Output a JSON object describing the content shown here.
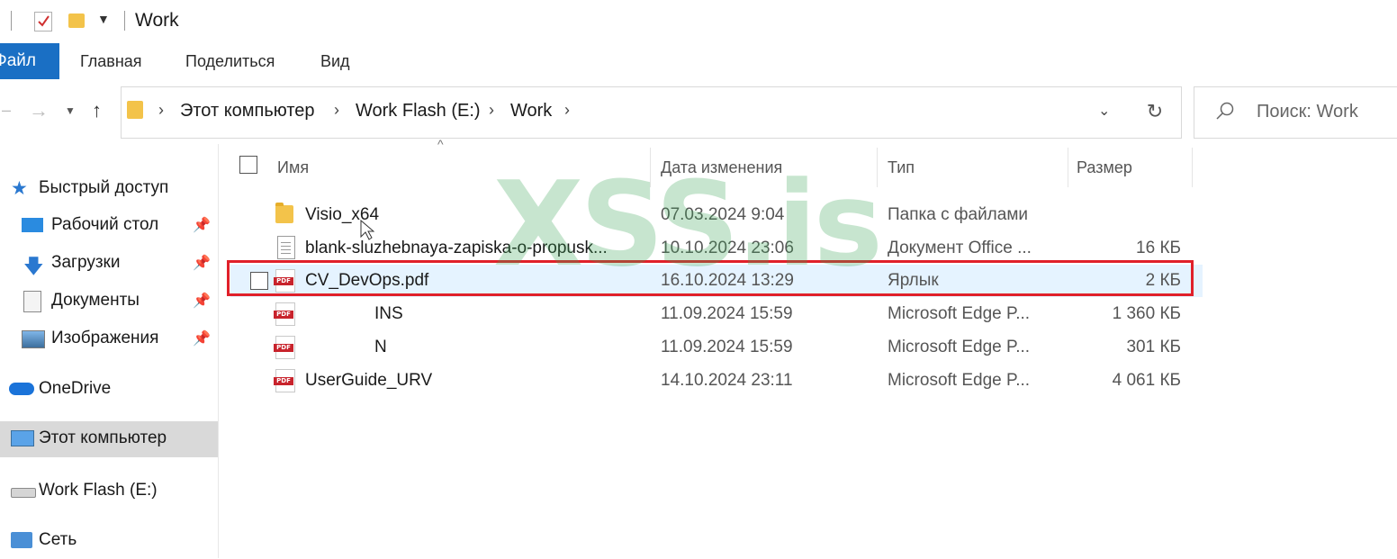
{
  "window": {
    "title": "Work"
  },
  "ribbon": {
    "file_label": "Файл",
    "tabs": [
      "Главная",
      "Поделиться",
      "Вид"
    ]
  },
  "address": {
    "crumbs": [
      "Этот компьютер",
      "Work Flash (E:)",
      "Work"
    ],
    "search_placeholder": "Поиск: Work"
  },
  "sidebar": {
    "items": [
      {
        "label": "Быстрый доступ",
        "icon": "star-icon",
        "pinned": false
      },
      {
        "label": "Рабочий стол",
        "icon": "desktop-icon",
        "pinned": true
      },
      {
        "label": "Загрузки",
        "icon": "download-icon",
        "pinned": true
      },
      {
        "label": "Документы",
        "icon": "documents-icon",
        "pinned": true
      },
      {
        "label": "Изображения",
        "icon": "pictures-icon",
        "pinned": true
      },
      {
        "label": "OneDrive",
        "icon": "cloud-icon",
        "pinned": false
      },
      {
        "label": "Этот компьютер",
        "icon": "computer-icon",
        "pinned": false,
        "selected": true
      },
      {
        "label": "Work Flash (E:)",
        "icon": "drive-icon",
        "pinned": false
      },
      {
        "label": "Сеть",
        "icon": "network-icon",
        "pinned": false
      }
    ]
  },
  "columns": {
    "name": "Имя",
    "date": "Дата изменения",
    "type": "Тип",
    "size": "Размер"
  },
  "files": [
    {
      "name": "Visio_x64",
      "date": "07.03.2024 9:04",
      "type": "Папка с файлами",
      "size": "",
      "icon": "folder-icon"
    },
    {
      "name": "blank-sluzhebnaya-zapiska-o-propusk...",
      "date": "10.10.2024 23:06",
      "type": "Документ Office ...",
      "size": "16 КБ",
      "icon": "document-icon"
    },
    {
      "name": "CV_DevOps.pdf",
      "date": "16.10.2024 13:29",
      "type": "Ярлык",
      "size": "2 КБ",
      "icon": "pdf-icon",
      "selected": true
    },
    {
      "name": "INS",
      "date": "11.09.2024 15:59",
      "type": "Microsoft Edge P...",
      "size": "1 360 КБ",
      "icon": "pdf-icon"
    },
    {
      "name": "N",
      "date": "11.09.2024 15:59",
      "type": "Microsoft Edge P...",
      "size": "301 КБ",
      "icon": "pdf-icon"
    },
    {
      "name": "UserGuide_URV",
      "date": "14.10.2024 23:11",
      "type": "Microsoft Edge P...",
      "size": "4 061 КБ",
      "icon": "pdf-icon"
    }
  ],
  "watermark": "XSS.is",
  "colors": {
    "accent": "#1a6fc4",
    "selection": "#e5f3ff",
    "highlight_border": "#e0202a",
    "pdf_red": "#c8232c"
  }
}
